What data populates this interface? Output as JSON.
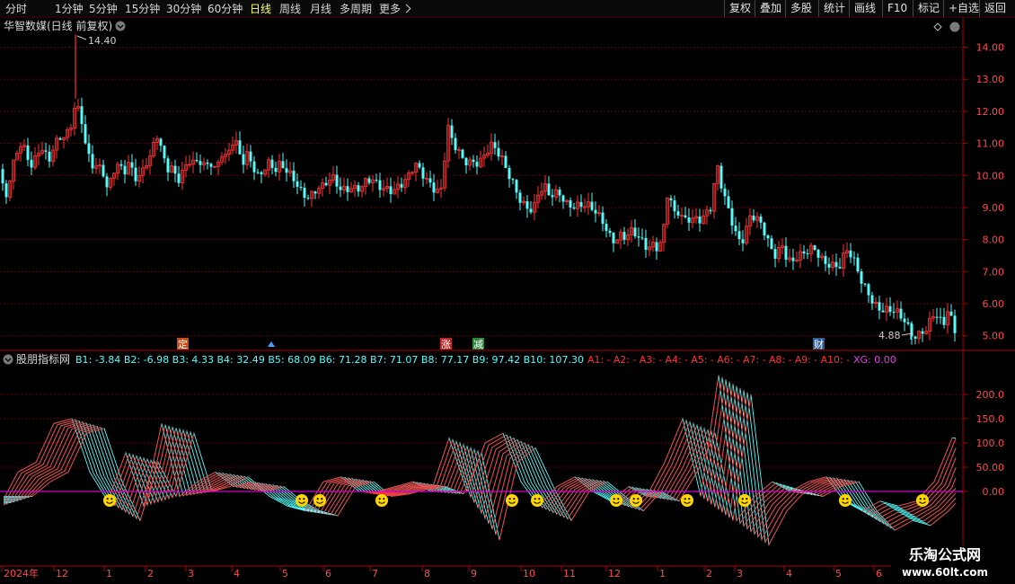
{
  "toolbar": {
    "periods": [
      "分时",
      "1分钟",
      "5分钟",
      "15分钟",
      "30分钟",
      "60分钟",
      "日线",
      "周线",
      "月线",
      "多周期"
    ],
    "active_period": "日线",
    "more_label": "更多",
    "right_buttons": [
      "复权",
      "叠加",
      "多股",
      "统计",
      "画线",
      "F10",
      "标记",
      "+自选",
      "返回"
    ]
  },
  "main_panel": {
    "title": "华智数媒(日线 前复权)",
    "y_ticks": [
      "14.00",
      "13.00",
      "12.00",
      "11.00",
      "10.00",
      "9.00",
      "8.00",
      "7.00",
      "6.00",
      "5.00"
    ],
    "high_label": "14.40",
    "low_label": "4.88",
    "event_markers": [
      {
        "text": "定",
        "color": "#c84a1a"
      },
      {
        "text": "涨",
        "color": "#b8282a"
      },
      {
        "text": "减",
        "color": "#2a8a3a"
      },
      {
        "text": "财",
        "color": "#2a5a9a"
      }
    ]
  },
  "indicator_panel": {
    "name": "股朋指标网",
    "values_b": "B1: -3.84  B2: -6.98  B3: 4.33  B4: 32.49  B5: 68.09  B6: 71.28  B7: 71.07  B8: 77.17  B9: 97.42  B10: 107.30",
    "values_a": "A1: -  A2: -  A3: -  A4: -  A5: -  A6: -  A7: -  A8: -  A9: -  A10: -",
    "value_xg": "XG: 0.00",
    "y_ticks": [
      "200.0",
      "150.0",
      "100.0",
      "50.00",
      "0.00"
    ]
  },
  "time_axis": {
    "labels": [
      "2024年",
      "12",
      "1",
      "2",
      "3",
      "4",
      "5",
      "6",
      "7",
      "8",
      "9",
      "10",
      "11",
      "12",
      "1",
      "2",
      "3",
      "4",
      "5",
      "6"
    ]
  },
  "watermark": {
    "line1": "乐淘公式网",
    "line2": "www.60lt.com"
  },
  "colors": {
    "up": "#ff3232",
    "down": "#54fcfc",
    "grid": "#7a0000",
    "axis": "#b00000",
    "tick_text": "#ff4b4b",
    "zero_line": "#d000d0",
    "smiley": "#ffd700"
  },
  "chart_data": [
    {
      "type": "candlestick",
      "title": "华智数媒(日线 前复权)",
      "ylim": [
        4.6,
        14.8
      ],
      "points": [
        [
          0,
          10.2
        ],
        [
          6,
          9.4
        ],
        [
          12,
          10.0
        ],
        [
          18,
          10.6
        ],
        [
          24,
          10.8
        ],
        [
          30,
          10.5
        ],
        [
          36,
          10.2
        ],
        [
          42,
          10.9
        ],
        [
          48,
          11.0
        ],
        [
          54,
          10.6
        ],
        [
          60,
          10.9
        ],
        [
          66,
          11.1
        ],
        [
          72,
          11.0
        ],
        [
          78,
          11.3
        ],
        [
          84,
          12.2
        ],
        [
          90,
          12.0
        ],
        [
          96,
          11.0
        ],
        [
          102,
          10.5
        ],
        [
          108,
          10.3
        ],
        [
          114,
          10.1
        ],
        [
          120,
          9.3
        ],
        [
          126,
          10.0
        ],
        [
          132,
          10.3
        ],
        [
          138,
          10.2
        ],
        [
          144,
          10.6
        ],
        [
          150,
          10.1
        ],
        [
          156,
          10.0
        ],
        [
          162,
          10.3
        ],
        [
          168,
          10.4
        ],
        [
          174,
          11.2
        ],
        [
          180,
          10.7
        ],
        [
          186,
          10.3
        ],
        [
          192,
          10.4
        ],
        [
          198,
          10.0
        ],
        [
          204,
          10.2
        ],
        [
          210,
          10.4
        ],
        [
          216,
          10.2
        ],
        [
          222,
          10.3
        ],
        [
          228,
          10.2
        ],
        [
          234,
          10.5
        ],
        [
          240,
          10.3
        ],
        [
          246,
          10.9
        ],
        [
          252,
          10.6
        ],
        [
          258,
          11.0
        ],
        [
          264,
          10.8
        ],
        [
          270,
          10.2
        ],
        [
          276,
          10.6
        ],
        [
          282,
          10.3
        ],
        [
          288,
          10.1
        ],
        [
          294,
          10.4
        ],
        [
          300,
          10.5
        ],
        [
          306,
          10.1
        ],
        [
          312,
          10.2
        ],
        [
          318,
          10.0
        ],
        [
          324,
          9.9
        ],
        [
          330,
          9.8
        ],
        [
          336,
          9.6
        ],
        [
          342,
          9.5
        ],
        [
          348,
          9.5
        ],
        [
          354,
          9.6
        ],
        [
          360,
          9.5
        ],
        [
          366,
          9.7
        ],
        [
          372,
          9.8
        ],
        [
          378,
          9.6
        ],
        [
          384,
          9.7
        ],
        [
          390,
          9.8
        ],
        [
          396,
          9.7
        ],
        [
          402,
          9.6
        ],
        [
          408,
          9.7
        ],
        [
          414,
          9.7
        ],
        [
          420,
          9.6
        ],
        [
          426,
          9.6
        ],
        [
          432,
          9.7
        ],
        [
          438,
          9.7
        ],
        [
          444,
          9.8
        ],
        [
          450,
          9.8
        ],
        [
          456,
          9.9
        ],
        [
          462,
          10.2
        ],
        [
          468,
          10.0
        ],
        [
          474,
          9.9
        ],
        [
          480,
          9.8
        ],
        [
          486,
          9.7
        ],
        [
          492,
          9.7
        ],
        [
          498,
          11.6
        ],
        [
          504,
          10.9
        ],
        [
          510,
          10.6
        ],
        [
          516,
          10.3
        ],
        [
          522,
          10.4
        ],
        [
          528,
          10.5
        ],
        [
          534,
          10.6
        ],
        [
          540,
          10.8
        ],
        [
          546,
          11.0
        ],
        [
          552,
          10.7
        ],
        [
          558,
          10.4
        ],
        [
          564,
          10.0
        ],
        [
          570,
          9.8
        ],
        [
          576,
          9.5
        ],
        [
          582,
          9.3
        ],
        [
          588,
          9.1
        ],
        [
          594,
          9.0
        ],
        [
          600,
          9.4
        ],
        [
          606,
          9.5
        ],
        [
          612,
          9.2
        ],
        [
          618,
          9.4
        ],
        [
          624,
          9.5
        ],
        [
          630,
          9.3
        ],
        [
          636,
          9.2
        ],
        [
          642,
          9.1
        ],
        [
          648,
          9.0
        ],
        [
          654,
          8.9
        ],
        [
          660,
          8.8
        ],
        [
          666,
          8.7
        ],
        [
          672,
          8.6
        ],
        [
          678,
          8.3
        ],
        [
          684,
          8.1
        ],
        [
          690,
          8.2
        ],
        [
          696,
          8.0
        ],
        [
          702,
          8.1
        ],
        [
          708,
          8.0
        ],
        [
          714,
          7.9
        ],
        [
          720,
          7.8
        ],
        [
          726,
          8.0
        ],
        [
          732,
          7.9
        ],
        [
          738,
          8.2
        ],
        [
          744,
          9.6
        ],
        [
          750,
          8.6
        ],
        [
          756,
          8.7
        ],
        [
          762,
          8.5
        ],
        [
          768,
          8.7
        ],
        [
          774,
          8.8
        ],
        [
          780,
          8.8
        ],
        [
          786,
          8.9
        ],
        [
          792,
          9.0
        ],
        [
          798,
          10.2
        ],
        [
          804,
          9.4
        ],
        [
          810,
          8.9
        ],
        [
          816,
          8.5
        ],
        [
          822,
          8.1
        ],
        [
          828,
          8.2
        ],
        [
          834,
          8.8
        ],
        [
          840,
          8.7
        ],
        [
          846,
          8.4
        ],
        [
          852,
          8.0
        ],
        [
          858,
          7.6
        ],
        [
          864,
          7.5
        ],
        [
          870,
          8.0
        ],
        [
          876,
          7.6
        ],
        [
          882,
          7.4
        ],
        [
          888,
          7.5
        ],
        [
          894,
          7.4
        ],
        [
          900,
          7.5
        ],
        [
          906,
          7.6
        ],
        [
          912,
          7.5
        ],
        [
          918,
          7.4
        ],
        [
          924,
          7.4
        ],
        [
          930,
          7.3
        ],
        [
          936,
          7.2
        ],
        [
          942,
          7.6
        ],
        [
          948,
          7.3
        ],
        [
          954,
          7.0
        ],
        [
          960,
          6.6
        ],
        [
          966,
          6.5
        ],
        [
          972,
          6.2
        ],
        [
          978,
          6.0
        ],
        [
          984,
          5.8
        ],
        [
          990,
          5.7
        ],
        [
          996,
          5.6
        ],
        [
          1002,
          5.5
        ],
        [
          1008,
          5.4
        ],
        [
          1014,
          5.2
        ],
        [
          1020,
          5.1
        ],
        [
          1026,
          5.3
        ],
        [
          1032,
          5.2
        ],
        [
          1038,
          5.6
        ],
        [
          1044,
          5.4
        ],
        [
          1050,
          5.2
        ],
        [
          1056,
          5.8
        ],
        [
          1062,
          5.3
        ]
      ],
      "high_point": {
        "x": 84,
        "y": 14.4
      },
      "low_point": {
        "x": 1014,
        "y": 4.88
      }
    },
    {
      "type": "line",
      "title": "股朋指标网",
      "ylim": [
        -150,
        250
      ],
      "series": [
        {
          "name": "B1",
          "points": [
            [
              0,
              -30
            ],
            [
              20,
              40
            ],
            [
              40,
              60
            ],
            [
              60,
              140
            ],
            [
              80,
              150
            ],
            [
              100,
              40
            ],
            [
              120,
              -20
            ],
            [
              140,
              80
            ],
            [
              160,
              -30
            ],
            [
              180,
              140
            ],
            [
              200,
              -10
            ],
            [
              220,
              20
            ],
            [
              240,
              40
            ],
            [
              260,
              10
            ],
            [
              280,
              20
            ],
            [
              300,
              -10
            ],
            [
              320,
              -30
            ],
            [
              340,
              -40
            ],
            [
              360,
              20
            ],
            [
              380,
              30
            ],
            [
              400,
              0
            ],
            [
              420,
              0
            ],
            [
              440,
              10
            ],
            [
              460,
              20
            ],
            [
              480,
              0
            ],
            [
              500,
              110
            ],
            [
              520,
              0
            ],
            [
              540,
              100
            ],
            [
              560,
              120
            ],
            [
              580,
              20
            ],
            [
              600,
              -30
            ],
            [
              620,
              10
            ],
            [
              640,
              30
            ],
            [
              660,
              0
            ],
            [
              680,
              -20
            ],
            [
              700,
              10
            ],
            [
              720,
              -10
            ],
            [
              740,
              60
            ],
            [
              760,
              150
            ],
            [
              780,
              -10
            ],
            [
              800,
              240
            ],
            [
              820,
              -60
            ],
            [
              840,
              -10
            ],
            [
              860,
              20
            ],
            [
              880,
              0
            ],
            [
              900,
              20
            ],
            [
              920,
              30
            ],
            [
              940,
              -20
            ],
            [
              960,
              -40
            ],
            [
              980,
              -20
            ],
            [
              1000,
              -30
            ],
            [
              1020,
              -20
            ],
            [
              1040,
              20
            ],
            [
              1060,
              110
            ]
          ]
        },
        {
          "name": "B10",
          "points": [
            [
              0,
              -10
            ],
            [
              20,
              20
            ],
            [
              40,
              40
            ],
            [
              60,
              120
            ],
            [
              80,
              130
            ],
            [
              100,
              20
            ],
            [
              120,
              -60
            ],
            [
              140,
              60
            ],
            [
              160,
              -10
            ],
            [
              180,
              120
            ],
            [
              200,
              0
            ],
            [
              220,
              10
            ],
            [
              240,
              30
            ],
            [
              260,
              0
            ],
            [
              280,
              10
            ],
            [
              300,
              -20
            ],
            [
              320,
              -40
            ],
            [
              340,
              -50
            ],
            [
              360,
              10
            ],
            [
              380,
              20
            ],
            [
              400,
              -10
            ],
            [
              420,
              -5
            ],
            [
              440,
              5
            ],
            [
              460,
              10
            ],
            [
              480,
              -5
            ],
            [
              500,
              80
            ],
            [
              520,
              -100
            ],
            [
              540,
              60
            ],
            [
              560,
              90
            ],
            [
              580,
              10
            ],
            [
              600,
              -60
            ],
            [
              620,
              0
            ],
            [
              640,
              20
            ],
            [
              660,
              -10
            ],
            [
              680,
              -40
            ],
            [
              700,
              0
            ],
            [
              720,
              -20
            ],
            [
              740,
              40
            ],
            [
              760,
              120
            ],
            [
              780,
              -60
            ],
            [
              800,
              200
            ],
            [
              820,
              -110
            ],
            [
              840,
              -40
            ],
            [
              860,
              0
            ],
            [
              880,
              -10
            ],
            [
              900,
              10
            ],
            [
              920,
              20
            ],
            [
              940,
              -40
            ],
            [
              960,
              -80
            ],
            [
              980,
              -60
            ],
            [
              1000,
              -70
            ],
            [
              1020,
              -40
            ],
            [
              1040,
              0
            ],
            [
              1060,
              100
            ]
          ]
        }
      ],
      "smiley_markers_x": [
        122,
        336,
        356,
        425,
        570,
        598,
        686,
        708,
        765,
        829,
        941,
        1027
      ]
    }
  ]
}
